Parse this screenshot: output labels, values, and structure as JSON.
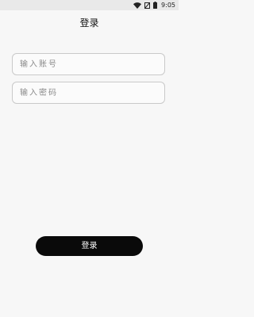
{
  "status_bar": {
    "time": "9:05",
    "icons": [
      "wifi-icon",
      "sim-icon",
      "battery-icon"
    ]
  },
  "header": {
    "title": "登录"
  },
  "form": {
    "account_placeholder": "输入账号",
    "password_placeholder": "输入密码",
    "account_value": "",
    "password_value": ""
  },
  "actions": {
    "login_label": "登录"
  },
  "colors": {
    "background": "#f7f7f7",
    "status_bar": "#e9e9e9",
    "button": "#0a0a0a",
    "button_text": "#ffffff",
    "field_border": "#c9c9c9",
    "placeholder": "#8a8a8a"
  }
}
